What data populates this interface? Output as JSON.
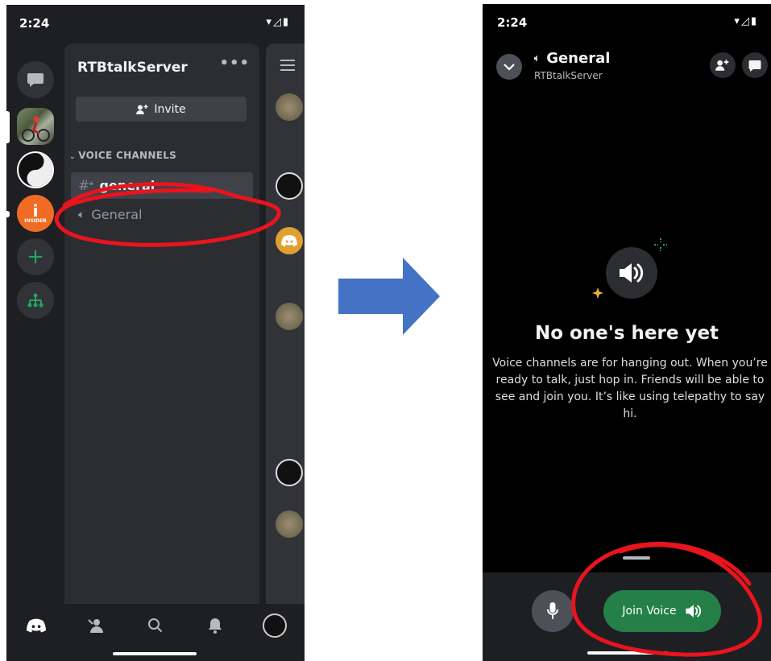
{
  "left_screen": {
    "status_time": "2:24",
    "server_name": "RTBtalkServer",
    "menu_icon": "more-dots-icon",
    "invite_label": "Invite",
    "category_label": "VOICE CHANNELS",
    "channels": [
      {
        "name": "general",
        "icon": "locked-hash-icon",
        "selected": true
      },
      {
        "name": "General",
        "icon": "speaker-icon",
        "selected": false
      }
    ],
    "guilds": [
      "dm-icon",
      "cyclist-photo",
      "yin-yang-avatar",
      "insider-logo",
      "add-server-icon",
      "discover-icon"
    ],
    "nav": [
      "discord-home-icon",
      "friends-icon",
      "search-icon",
      "bell-icon",
      "profile-avatar"
    ]
  },
  "right_screen": {
    "status_time": "2:24",
    "channel_name": "General",
    "server_name": "RTBtalkServer",
    "empty_title": "No one's here yet",
    "empty_body": "Voice channels are for hanging out. When you’re ready to talk, just hop in. Friends will be able to see and join you. It’s like using telepathy to say hi.",
    "join_label": "Join Voice"
  },
  "colors": {
    "annotation_red": "#e8141e",
    "arrow_blue": "#4472c4",
    "join_green": "#248046"
  }
}
